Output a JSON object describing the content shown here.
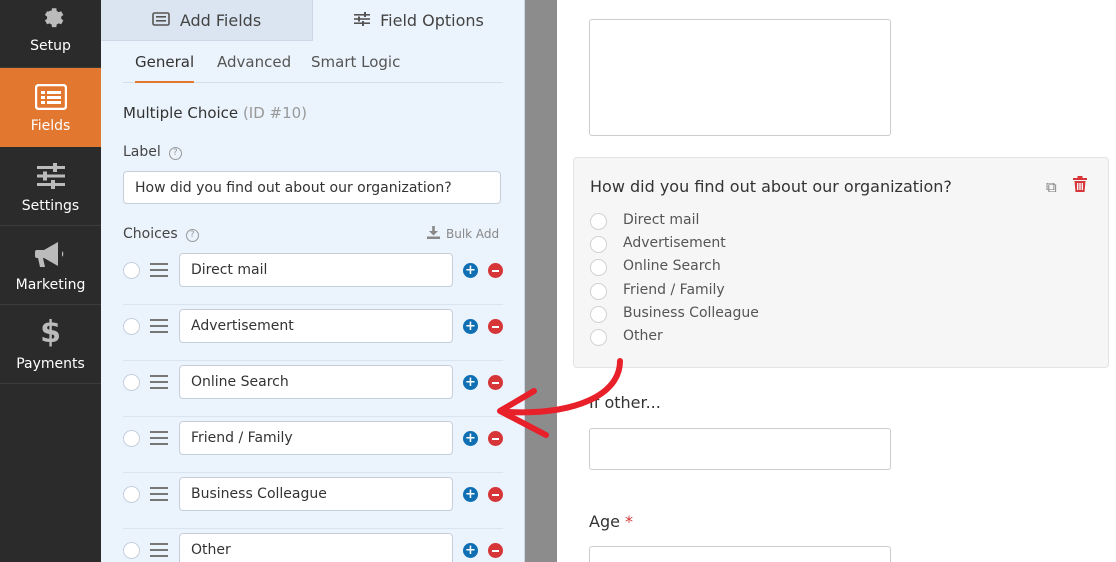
{
  "nav": {
    "items": [
      {
        "label": "Setup",
        "icon": "gear-icon",
        "active": false
      },
      {
        "label": "Fields",
        "icon": "list-icon",
        "active": true
      },
      {
        "label": "Settings",
        "icon": "sliders-icon",
        "active": false
      },
      {
        "label": "Marketing",
        "icon": "megaphone-icon",
        "active": false
      },
      {
        "label": "Payments",
        "icon": "dollar-icon",
        "active": false
      }
    ]
  },
  "panel": {
    "tabs": {
      "add_fields": "Add Fields",
      "field_options": "Field Options"
    },
    "subtabs": {
      "general": "General",
      "advanced": "Advanced",
      "smart_logic": "Smart Logic"
    },
    "field_type": "Multiple Choice",
    "field_id": "(ID #10)",
    "label_caption": "Label",
    "label_value": "How did you find out about our organization?",
    "choices_caption": "Choices",
    "bulk_add": "Bulk Add",
    "choices": [
      "Direct mail",
      "Advertisement",
      "Online Search",
      "Friend / Family",
      "Business Colleague",
      "Other"
    ]
  },
  "preview": {
    "question": "How did you find out about our organization?",
    "options": [
      "Direct mail",
      "Advertisement",
      "Online Search",
      "Friend / Family",
      "Business Colleague",
      "Other"
    ],
    "if_other_label": "If other...",
    "age_label": "Age",
    "required_mark": "*"
  },
  "colors": {
    "accent": "#e27730",
    "panel_bg": "#ebf3fc",
    "nav_bg": "#2b2b2b",
    "plus": "#0e6fb4",
    "minus": "#d63638",
    "arrow": "#e8202a"
  }
}
